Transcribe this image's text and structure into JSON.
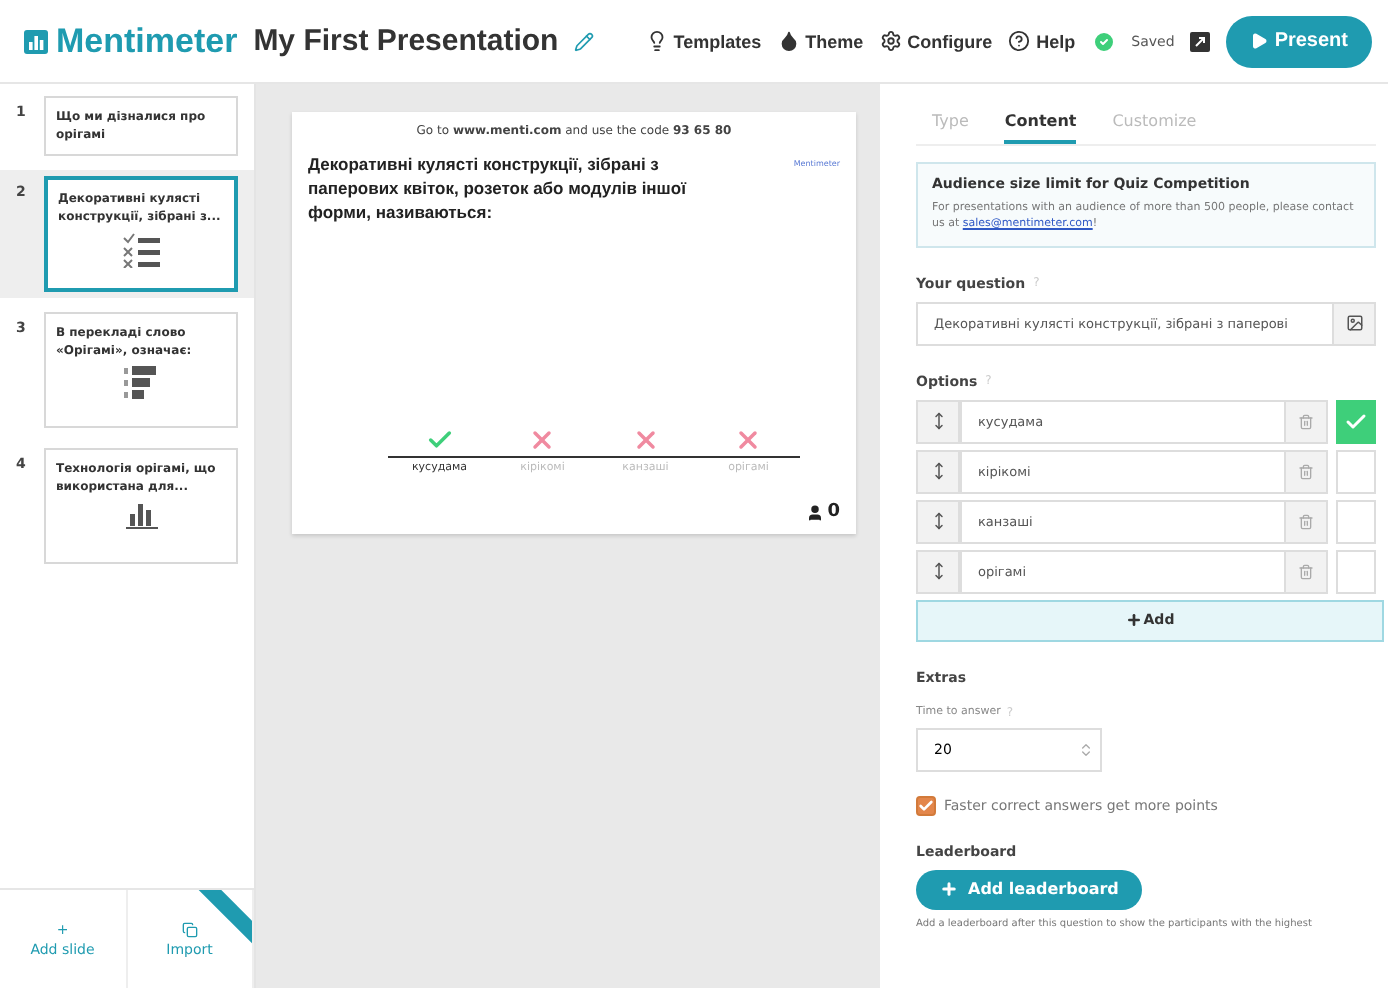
{
  "header": {
    "logo": "Mentimeter",
    "title": "My First Presentation",
    "nav": [
      {
        "label": "Templates",
        "kind": "bulb"
      },
      {
        "label": "Theme",
        "kind": "drop"
      },
      {
        "label": "Configure",
        "kind": "gear"
      },
      {
        "label": "Help",
        "kind": "help"
      }
    ],
    "status": "Saved",
    "present": "Present"
  },
  "slides": [
    {
      "number": "1",
      "title": "Що ми дізналися про орігамі",
      "kind": "text",
      "selected": false
    },
    {
      "number": "2",
      "title": "Декоративні кулясті конструкції, зібрані з...",
      "kind": "quiz",
      "selected": true
    },
    {
      "number": "3",
      "title": "В перекладі слово «Орігамі», означає:",
      "kind": "ranking",
      "selected": false
    },
    {
      "number": "4",
      "title": "Технологія орігамі, що використана для...",
      "kind": "bars",
      "selected": false
    }
  ],
  "sidebar_footer": [
    {
      "label": "Add slide",
      "icon": "+"
    },
    {
      "label": "Import",
      "kind": "import"
    }
  ],
  "preview": {
    "instructions_before": "Go to ",
    "site": "www.menti.com",
    "instructions_mid": " and use the code ",
    "code": "93 65 80",
    "brand": "Mentimeter",
    "question": "Декоративні кулясті конструкції, зібрані з паперових квіток, розеток або модулів іншої форми, називаються:",
    "answers": [
      {
        "label": "кусудама",
        "correct": true
      },
      {
        "label": "кірікомі",
        "correct": false
      },
      {
        "label": "канзаші",
        "correct": false
      },
      {
        "label": "орігамі",
        "correct": false
      }
    ],
    "participants": "0"
  },
  "panel": {
    "tabs": [
      {
        "label": "Type",
        "selected": false
      },
      {
        "label": "Content",
        "selected": true
      },
      {
        "label": "Customize",
        "selected": false
      }
    ],
    "notice": {
      "title": "Audience size limit for Quiz Competition",
      "text": "For presentations with an audience of more than 500 people, please contact us at ",
      "link": "sales@mentimeter.com",
      "after": "!"
    },
    "question_label": "Your question",
    "question_help": "?",
    "question_value": "Декоративні кулясті конструкції, зібрані з паперові",
    "options_label": "Options",
    "options_help": "?",
    "options": [
      {
        "value": "кусудама",
        "checked": true
      },
      {
        "value": "кірікомі",
        "checked": false
      },
      {
        "value": "канзаші",
        "checked": false
      },
      {
        "value": "орігамі",
        "checked": false
      }
    ],
    "add_label": "Add",
    "extras_label": "Extras",
    "time_label": "Time to answer",
    "time_help": "?",
    "time_value": "20",
    "faster": {
      "label": "Faster correct answers get more points",
      "checked": true
    },
    "leaderboard_label": "Leaderboard",
    "leaderboard_button": "Add leaderboard",
    "leaderboard_text": "Add a leaderboard after this question to show the participants with the highest"
  }
}
